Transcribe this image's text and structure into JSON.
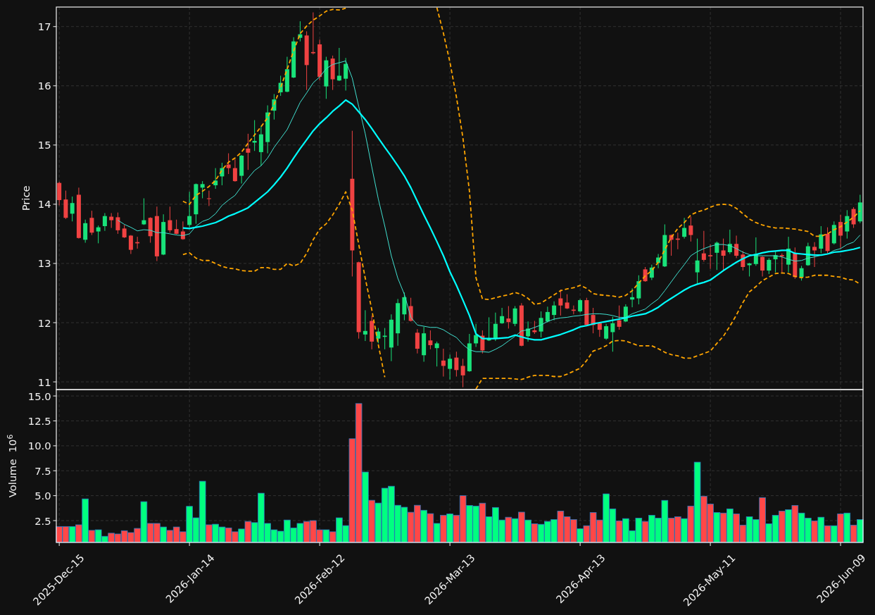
{
  "price_chart": {
    "chart_data": {
      "type": "candlestick",
      "ylabel": "Price",
      "grid": true,
      "categories": [
        null,
        null,
        null,
        null,
        null,
        null,
        null,
        null,
        null,
        null,
        null,
        null,
        null,
        null,
        null,
        null,
        null,
        null,
        null,
        null,
        null,
        null,
        null,
        null,
        null,
        null,
        null,
        null,
        null,
        null,
        null,
        null,
        null,
        null,
        null,
        null,
        null,
        null,
        null,
        null,
        null,
        null,
        null,
        null,
        null,
        null,
        null,
        null,
        null,
        null,
        null,
        null,
        null,
        null,
        null,
        null,
        null,
        null,
        null,
        null,
        null,
        null,
        null,
        null,
        null,
        null,
        null,
        null,
        null,
        null,
        null,
        null,
        null,
        null,
        null,
        null,
        null,
        null,
        null,
        null,
        null,
        null,
        null,
        null,
        null,
        null,
        null,
        null,
        null,
        null,
        null,
        null,
        null,
        null,
        null,
        null,
        null,
        null,
        null,
        null,
        null,
        null,
        null,
        null,
        null,
        null,
        null,
        null,
        null,
        null,
        null,
        null,
        null,
        null,
        null,
        null,
        null,
        null,
        null,
        null,
        null,
        null,
        null,
        null
      ],
      "ylim": [
        10.87,
        17.33
      ],
      "yticks": [
        11,
        12,
        13,
        14,
        15,
        16,
        17
      ],
      "ohlc": [
        [
          14.36,
          14.38,
          13.98,
          14.07
        ],
        [
          14.08,
          14.23,
          13.75,
          13.77
        ],
        [
          13.84,
          14.13,
          13.71,
          14.02
        ],
        [
          14.16,
          14.28,
          13.42,
          13.43
        ],
        [
          13.4,
          13.74,
          13.35,
          13.68
        ],
        [
          13.77,
          13.89,
          13.48,
          13.52
        ],
        [
          13.54,
          13.64,
          13.34,
          13.61
        ],
        [
          13.63,
          13.85,
          13.55,
          13.8
        ],
        [
          13.79,
          13.85,
          13.6,
          13.73
        ],
        [
          13.78,
          13.86,
          13.5,
          13.56
        ],
        [
          13.59,
          13.65,
          13.43,
          13.44
        ],
        [
          13.47,
          13.48,
          13.16,
          13.23
        ],
        [
          13.36,
          13.45,
          13.25,
          13.34
        ],
        [
          13.66,
          14.1,
          13.65,
          13.73
        ],
        [
          13.77,
          13.78,
          13.35,
          13.46
        ],
        [
          13.8,
          13.96,
          13.04,
          13.12
        ],
        [
          13.15,
          13.83,
          13.14,
          13.7
        ],
        [
          13.73,
          13.96,
          13.52,
          13.56
        ],
        [
          13.58,
          13.74,
          13.49,
          13.5
        ],
        [
          13.54,
          13.71,
          13.4,
          13.41
        ],
        [
          13.65,
          14.21,
          13.61,
          13.8
        ],
        [
          13.83,
          14.35,
          13.67,
          14.34
        ],
        [
          14.28,
          14.39,
          14.1,
          14.34
        ],
        [
          14.1,
          14.23,
          13.97,
          14.09
        ],
        [
          14.32,
          14.61,
          14.26,
          14.4
        ],
        [
          14.47,
          14.7,
          14.32,
          14.61
        ],
        [
          14.67,
          14.86,
          14.51,
          14.61
        ],
        [
          14.61,
          14.76,
          14.38,
          14.39
        ],
        [
          14.48,
          14.83,
          14.35,
          14.82
        ],
        [
          14.94,
          15.19,
          14.58,
          14.87
        ],
        [
          15.04,
          15.42,
          14.9,
          15.07
        ],
        [
          14.88,
          15.32,
          14.65,
          15.18
        ],
        [
          15.05,
          15.67,
          14.86,
          15.55
        ],
        [
          15.58,
          15.86,
          15.43,
          15.77
        ],
        [
          15.89,
          16.17,
          15.83,
          16.05
        ],
        [
          15.9,
          16.49,
          15.89,
          16.28
        ],
        [
          16.14,
          16.82,
          16.13,
          16.75
        ],
        [
          16.81,
          17.09,
          16.75,
          16.87
        ],
        [
          16.85,
          16.92,
          15.93,
          16.35
        ],
        [
          16.57,
          17.24,
          16.53,
          16.55
        ],
        [
          16.7,
          16.78,
          16.09,
          16.15
        ],
        [
          15.99,
          16.49,
          15.78,
          16.43
        ],
        [
          16.46,
          16.51,
          15.93,
          16.11
        ],
        [
          16.09,
          16.64,
          16.08,
          16.17
        ],
        [
          16.12,
          16.47,
          15.92,
          16.37
        ],
        [
          14.43,
          15.24,
          12.78,
          13.22
        ],
        [
          13.02,
          13.03,
          11.73,
          11.84
        ],
        [
          11.8,
          12.21,
          11.69,
          11.86
        ],
        [
          12.03,
          12.12,
          11.55,
          11.68
        ],
        [
          11.73,
          11.91,
          11.65,
          11.85
        ],
        [
          11.76,
          11.91,
          11.55,
          11.78
        ],
        [
          11.58,
          12.14,
          11.35,
          12.05
        ],
        [
          11.82,
          12.4,
          11.61,
          12.33
        ],
        [
          12.14,
          12.51,
          12.04,
          12.43
        ],
        [
          12.28,
          12.42,
          12.02,
          12.03
        ],
        [
          11.83,
          11.89,
          11.48,
          11.56
        ],
        [
          11.45,
          11.93,
          11.34,
          11.82
        ],
        [
          11.7,
          11.87,
          11.55,
          11.62
        ],
        [
          11.57,
          11.68,
          11.26,
          11.65
        ],
        [
          11.36,
          11.56,
          11.09,
          11.27
        ],
        [
          11.22,
          11.46,
          11.04,
          11.39
        ],
        [
          11.41,
          11.51,
          11.09,
          11.2
        ],
        [
          11.27,
          11.39,
          10.91,
          11.11
        ],
        [
          11.18,
          11.81,
          11.17,
          11.65
        ],
        [
          11.65,
          11.98,
          11.59,
          11.79
        ],
        [
          11.78,
          11.87,
          11.48,
          11.53
        ],
        [
          11.7,
          12.09,
          11.69,
          11.74
        ],
        [
          11.73,
          12.17,
          11.69,
          11.98
        ],
        [
          11.99,
          12.25,
          11.98,
          12.11
        ],
        [
          12.07,
          12.28,
          11.9,
          12.01
        ],
        [
          11.98,
          12.28,
          11.94,
          12.24
        ],
        [
          12.29,
          12.33,
          11.6,
          11.61
        ],
        [
          11.77,
          12.02,
          11.68,
          11.9
        ],
        [
          11.87,
          12.03,
          11.81,
          11.84
        ],
        [
          11.85,
          12.19,
          11.75,
          12.08
        ],
        [
          12.02,
          12.27,
          12.0,
          12.18
        ],
        [
          12.13,
          12.36,
          12.04,
          12.29
        ],
        [
          12.41,
          12.56,
          12.12,
          12.29
        ],
        [
          12.34,
          12.48,
          12.23,
          12.24
        ],
        [
          12.22,
          12.29,
          12.14,
          12.2
        ],
        [
          12.19,
          12.4,
          12.17,
          12.38
        ],
        [
          12.38,
          12.42,
          11.95,
          11.96
        ],
        [
          12.13,
          12.25,
          11.82,
          11.96
        ],
        [
          11.99,
          12.0,
          11.76,
          11.88
        ],
        [
          11.73,
          11.98,
          11.71,
          11.94
        ],
        [
          11.84,
          12.1,
          11.51,
          11.99
        ],
        [
          12.04,
          12.29,
          11.88,
          11.93
        ],
        [
          12.02,
          12.31,
          12.01,
          12.27
        ],
        [
          12.39,
          12.58,
          12.26,
          12.43
        ],
        [
          12.41,
          12.8,
          12.31,
          12.7
        ],
        [
          12.9,
          12.94,
          12.69,
          12.7
        ],
        [
          12.76,
          12.98,
          12.72,
          12.93
        ],
        [
          13.01,
          13.16,
          12.92,
          13.1
        ],
        [
          12.95,
          13.66,
          12.94,
          13.48
        ],
        [
          13.48,
          13.49,
          13.13,
          13.4
        ],
        [
          13.42,
          13.52,
          13.24,
          13.4
        ],
        [
          13.45,
          13.77,
          13.42,
          13.6
        ],
        [
          13.64,
          13.79,
          13.37,
          13.48
        ],
        [
          12.85,
          13.42,
          12.66,
          13.05
        ],
        [
          13.17,
          13.55,
          13.03,
          13.06
        ],
        [
          13.14,
          13.32,
          12.91,
          13.12
        ],
        [
          13.18,
          13.37,
          12.89,
          13.35
        ],
        [
          13.22,
          13.42,
          12.89,
          13.13
        ],
        [
          13.19,
          13.57,
          13.16,
          13.33
        ],
        [
          13.33,
          13.47,
          13.09,
          13.13
        ],
        [
          13.15,
          13.21,
          12.88,
          12.94
        ],
        [
          12.97,
          13.01,
          12.78,
          13.0
        ],
        [
          12.99,
          13.44,
          12.96,
          13.16
        ],
        [
          13.11,
          13.12,
          12.78,
          12.88
        ],
        [
          12.88,
          13.09,
          12.82,
          13.06
        ],
        [
          13.07,
          13.2,
          12.85,
          13.14
        ],
        [
          13.14,
          13.17,
          12.85,
          13.12
        ],
        [
          12.98,
          13.45,
          12.85,
          13.25
        ],
        [
          13.17,
          13.27,
          12.74,
          12.77
        ],
        [
          12.77,
          12.96,
          12.71,
          12.92
        ],
        [
          12.97,
          13.35,
          12.96,
          13.29
        ],
        [
          13.28,
          13.36,
          12.94,
          13.22
        ],
        [
          13.25,
          13.63,
          13.17,
          13.49
        ],
        [
          13.5,
          13.61,
          13.17,
          13.21
        ],
        [
          13.34,
          13.71,
          13.32,
          13.65
        ],
        [
          13.7,
          13.82,
          13.25,
          13.47
        ],
        [
          13.54,
          13.9,
          13.42,
          13.8
        ],
        [
          13.92,
          13.95,
          13.6,
          13.66
        ],
        [
          13.71,
          14.16,
          13.68,
          14.03
        ]
      ],
      "series": [
        {
          "type": "line",
          "color": "#40e0d0",
          "line_style": "solid",
          "values": [
            null,
            null,
            null,
            null,
            null,
            null,
            null,
            null,
            null,
            13.73,
            13.66,
            13.61,
            13.55,
            13.57,
            13.56,
            13.52,
            13.52,
            13.5,
            13.48,
            13.47,
            13.5,
            13.63,
            13.71,
            13.75,
            13.84,
            13.98,
            14.07,
            14.15,
            14.3,
            14.44,
            14.57,
            14.65,
            14.78,
            14.96,
            15.11,
            15.26,
            15.49,
            15.72,
            15.88,
            16.05,
            16.15,
            16.29,
            16.36,
            16.39,
            16.42,
            16.13,
            15.65,
            15.19,
            14.63,
            14.09,
            13.63,
            13.13,
            12.75,
            12.48,
            12.09,
            11.96,
            11.94,
            11.92,
            11.92,
            11.88,
            11.81,
            11.75,
            11.63,
            11.54,
            11.51,
            11.51,
            11.5,
            11.55,
            11.61,
            11.69,
            11.77,
            11.86,
            11.88,
            11.92,
            11.96,
            12.02,
            12.06,
            12.08,
            12.09,
            12.11,
            12.12,
            12.14,
            12.15,
            12.15,
            12.14,
            12.12,
            12.09,
            12.09,
            12.15,
            12.19,
            12.23,
            12.32,
            12.4,
            12.54,
            12.69,
            12.84,
            12.98,
            13.13,
            13.2,
            13.25,
            13.29,
            13.32,
            13.32,
            13.3,
            13.25,
            13.19,
            13.15,
            13.13,
            13.13,
            13.13,
            13.13,
            13.11,
            13.07,
            13.04,
            13.05,
            13.09,
            13.11,
            13.14,
            13.16,
            13.22,
            13.25,
            13.32,
            13.36,
            13.48
          ]
        },
        {
          "type": "line",
          "color": "#00ffff",
          "line_style": "solid",
          "values": [
            null,
            null,
            null,
            null,
            null,
            null,
            null,
            null,
            null,
            null,
            null,
            null,
            null,
            null,
            null,
            null,
            null,
            null,
            null,
            13.6,
            13.59,
            13.61,
            13.63,
            13.66,
            13.69,
            13.74,
            13.8,
            13.84,
            13.89,
            13.94,
            14.03,
            14.12,
            14.21,
            14.33,
            14.46,
            14.61,
            14.78,
            14.94,
            15.09,
            15.24,
            15.36,
            15.46,
            15.57,
            15.66,
            15.76,
            15.69,
            15.56,
            15.43,
            15.28,
            15.12,
            14.96,
            14.81,
            14.65,
            14.48,
            14.28,
            14.05,
            13.82,
            13.6,
            13.37,
            13.13,
            12.86,
            12.63,
            12.38,
            12.12,
            11.81,
            11.73,
            11.73,
            11.73,
            11.74,
            11.75,
            11.79,
            11.76,
            11.73,
            11.71,
            11.71,
            11.74,
            11.77,
            11.8,
            11.84,
            11.88,
            11.93,
            11.95,
            11.98,
            12.0,
            12.02,
            12.04,
            12.06,
            12.08,
            12.11,
            12.13,
            12.15,
            12.2,
            12.26,
            12.34,
            12.41,
            12.48,
            12.55,
            12.61,
            12.65,
            12.68,
            12.72,
            12.8,
            12.88,
            12.95,
            13.02,
            13.08,
            13.13,
            13.15,
            13.18,
            13.2,
            13.21,
            13.22,
            13.22,
            13.17,
            13.16,
            13.15,
            13.14,
            13.14,
            13.16,
            13.19,
            13.2,
            13.22,
            13.24,
            13.27
          ]
        },
        {
          "type": "line",
          "color": "#ffa500",
          "line_style": "dashed",
          "values": [
            null,
            null,
            null,
            null,
            null,
            null,
            null,
            null,
            null,
            null,
            null,
            null,
            null,
            null,
            null,
            null,
            null,
            null,
            null,
            14.05,
            14.0,
            14.15,
            14.22,
            14.3,
            14.4,
            14.58,
            14.71,
            14.78,
            14.88,
            15.03,
            15.17,
            15.31,
            15.46,
            15.69,
            15.97,
            16.28,
            16.59,
            16.88,
            17.01,
            17.11,
            17.18,
            17.26,
            17.29,
            17.28,
            17.31,
            null,
            null,
            null,
            null,
            null,
            null,
            null,
            null,
            null,
            null,
            null,
            null,
            null,
            17.32,
            16.89,
            16.4,
            15.81,
            15.12,
            14.22,
            12.76,
            12.4,
            12.39,
            12.42,
            12.45,
            12.47,
            12.51,
            12.48,
            12.41,
            12.31,
            12.33,
            12.4,
            12.47,
            12.54,
            12.57,
            12.59,
            12.63,
            12.58,
            12.49,
            12.47,
            12.46,
            12.45,
            12.43,
            12.46,
            12.54,
            12.67,
            12.79,
            12.88,
            13.02,
            13.23,
            13.44,
            13.59,
            13.69,
            13.82,
            13.87,
            13.9,
            13.95,
            13.99,
            14.0,
            13.99,
            13.93,
            13.84,
            13.75,
            13.69,
            13.65,
            13.62,
            13.6,
            13.6,
            13.59,
            13.58,
            13.56,
            13.54,
            13.46,
            13.46,
            13.5,
            13.57,
            13.62,
            13.7,
            13.78,
            13.89
          ]
        },
        {
          "type": "line",
          "color": "#ffa500",
          "line_style": "dashed",
          "values": [
            null,
            null,
            null,
            null,
            null,
            null,
            null,
            null,
            null,
            null,
            null,
            null,
            null,
            null,
            null,
            null,
            null,
            null,
            null,
            13.15,
            13.18,
            13.09,
            13.05,
            13.05,
            13.0,
            12.95,
            12.92,
            12.91,
            12.88,
            12.87,
            12.87,
            12.93,
            12.93,
            12.9,
            12.9,
            13.0,
            12.96,
            13.0,
            13.17,
            13.4,
            13.58,
            13.67,
            13.82,
            14.0,
            14.21,
            13.9,
            13.32,
            12.75,
            12.22,
            11.63,
            11.08,
            null,
            null,
            null,
            null,
            null,
            null,
            null,
            null,
            null,
            null,
            null,
            null,
            null,
            10.88,
            11.06,
            11.06,
            11.06,
            11.06,
            11.06,
            11.05,
            11.04,
            11.08,
            11.11,
            11.11,
            11.11,
            11.09,
            11.09,
            11.13,
            11.18,
            11.23,
            11.36,
            11.52,
            11.56,
            11.61,
            11.69,
            11.7,
            11.69,
            11.65,
            11.61,
            11.61,
            11.61,
            11.56,
            11.5,
            11.46,
            11.44,
            11.4,
            11.4,
            11.44,
            11.48,
            11.52,
            11.65,
            11.77,
            11.94,
            12.13,
            12.34,
            12.52,
            12.61,
            12.71,
            12.77,
            12.83,
            12.84,
            12.83,
            12.78,
            12.76,
            12.77,
            12.8,
            12.8,
            12.8,
            12.78,
            12.77,
            12.73,
            12.72,
            12.65
          ]
        }
      ]
    }
  },
  "volume_chart": {
    "chart_data": {
      "type": "bar",
      "ylabel": "Volume  10$^{6}$",
      "grid": true,
      "categories": [
        "2025-Dec-15",
        null,
        null,
        null,
        null,
        null,
        null,
        null,
        null,
        null,
        null,
        null,
        null,
        null,
        null,
        null,
        null,
        null,
        null,
        null,
        "2026-Jan-14",
        null,
        null,
        null,
        null,
        null,
        null,
        null,
        null,
        null,
        null,
        null,
        null,
        null,
        null,
        null,
        null,
        null,
        null,
        null,
        "2026-Feb-12",
        null,
        null,
        null,
        null,
        null,
        null,
        null,
        null,
        null,
        null,
        null,
        null,
        null,
        null,
        null,
        null,
        null,
        null,
        null,
        "2026-Mar-13",
        null,
        null,
        null,
        null,
        null,
        null,
        null,
        null,
        null,
        null,
        null,
        null,
        null,
        null,
        null,
        null,
        null,
        null,
        null,
        "2026-Apr-13",
        null,
        null,
        null,
        null,
        null,
        null,
        null,
        null,
        null,
        null,
        null,
        null,
        null,
        null,
        null,
        null,
        null,
        null,
        null,
        "2026-May-11",
        null,
        null,
        null,
        null,
        null,
        null,
        null,
        null,
        null,
        null,
        null,
        null,
        null,
        null,
        null,
        null,
        null,
        null,
        null,
        "2026-Jun-09",
        null,
        null,
        null
      ],
      "ylim": [
        0.31,
        15.64
      ],
      "yticks": [
        {
          "value": 2.5,
          "label": "2.5"
        },
        {
          "value": 5,
          "label": "5.0"
        },
        {
          "value": 7.5,
          "label": "7.5"
        },
        {
          "value": 10,
          "label": "10.0"
        },
        {
          "value": 12.5,
          "label": "12.5"
        },
        {
          "value": 15,
          "label": "15.0"
        }
      ],
      "series": [
        {
          "values": [
            1.91,
            1.91,
            1.91,
            2.08,
            4.68,
            1.52,
            1.58,
            0.93,
            1.24,
            1.16,
            1.49,
            1.3,
            1.72,
            4.4,
            2.22,
            2.22,
            1.86,
            1.52,
            1.86,
            1.38,
            3.93,
            2.78,
            6.45,
            2.08,
            2.14,
            1.86,
            1.77,
            1.38,
            1.66,
            2.42,
            2.3,
            5.25,
            2.22,
            1.58,
            1.44,
            2.56,
            1.77,
            2.22,
            2.42,
            2.5,
            1.58,
            1.58,
            1.38,
            2.78,
            2.0,
            10.71,
            14.24,
            7.37,
            4.54,
            4.26,
            5.75,
            5.95,
            4.04,
            3.84,
            3.34,
            4.04,
            3.54,
            3.2,
            2.22,
            3.04,
            3.18,
            3.04,
            5.0,
            4.02,
            3.96,
            4.25,
            2.89,
            3.82,
            2.56,
            2.84,
            2.7,
            3.35,
            2.56,
            2.19,
            2.13,
            2.42,
            2.61,
            3.46,
            2.89,
            2.61,
            1.68,
            1.99,
            3.32,
            2.56,
            5.18,
            3.68,
            2.47,
            2.7,
            1.49,
            2.75,
            2.42,
            3.04,
            2.75,
            4.53,
            2.75,
            2.89,
            2.7,
            3.96,
            8.36,
            4.95,
            4.16,
            3.32,
            3.26,
            3.68,
            3.18,
            2.05,
            2.89,
            2.61,
            4.81,
            2.19,
            3.04,
            3.46,
            3.6,
            4.02,
            3.26,
            2.75,
            2.47,
            2.84,
            1.99,
            1.99,
            3.18,
            3.26,
            2.05,
            2.61
          ]
        }
      ]
    }
  }
}
